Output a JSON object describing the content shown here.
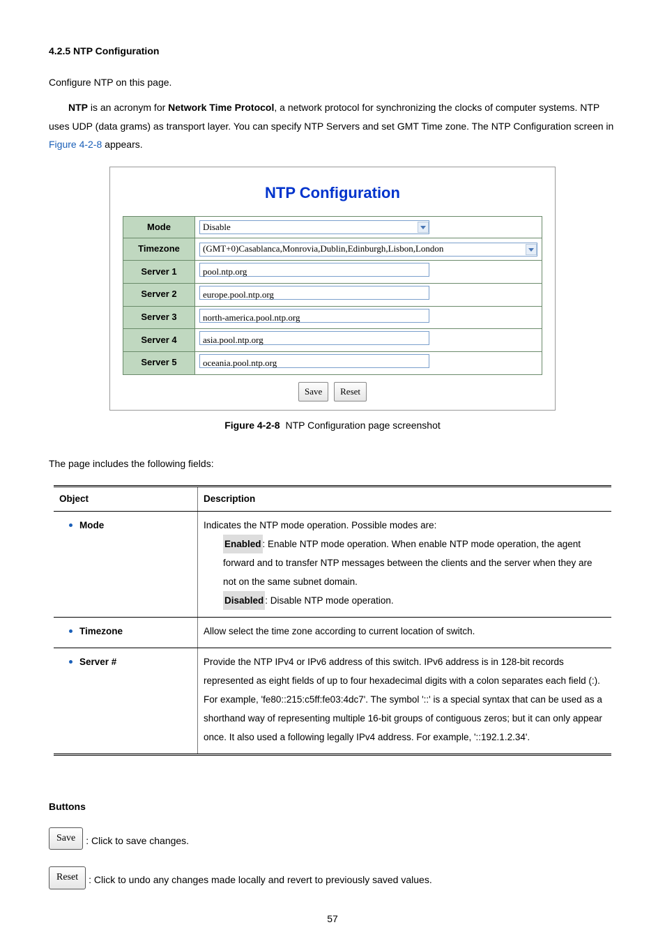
{
  "section": {
    "number": "4.2.5 NTP Configuration",
    "intro": "Configure NTP on this page.",
    "para_prefix": "NTP",
    "para_mid1": " is an acronym for ",
    "para_bold": "Network Time Protocol",
    "para_mid2": ", a network protocol for synchronizing the clocks of computer systems. NTP uses UDP (data grams) as transport layer. You can specify NTP Servers and set GMT Time zone. The NTP Configuration screen in ",
    "figref": "Figure 4-2-8",
    "para_end": " appears."
  },
  "shot": {
    "title": "NTP Configuration",
    "rows": {
      "mode": {
        "label": "Mode",
        "value": "Disable"
      },
      "timezone": {
        "label": "Timezone",
        "value": "(GMT+0)Casablanca,Monrovia,Dublin,Edinburgh,Lisbon,London"
      },
      "s1": {
        "label": "Server 1",
        "value": "pool.ntp.org"
      },
      "s2": {
        "label": "Server 2",
        "value": "europe.pool.ntp.org"
      },
      "s3": {
        "label": "Server 3",
        "value": "north-america.pool.ntp.org"
      },
      "s4": {
        "label": "Server 4",
        "value": "asia.pool.ntp.org"
      },
      "s5": {
        "label": "Server 5",
        "value": "oceania.pool.ntp.org"
      }
    },
    "save": "Save",
    "reset": "Reset"
  },
  "caption": {
    "figno": "Figure 4-2-8",
    "text": " NTP Configuration page screenshot"
  },
  "fields_intro": "The page includes the following fields:",
  "table": {
    "head_obj": "Object",
    "head_desc": "Description",
    "r1": {
      "obj": "Mode",
      "line1": "Indicates the NTP mode operation. Possible modes are:",
      "en_label": "Enabled",
      "en_text": ": Enable NTP mode operation. When enable NTP mode operation, the agent forward and to transfer NTP messages between the clients and the server when they are not on the same subnet domain.",
      "dis_label": "Disabled",
      "dis_text": ": Disable NTP mode operation."
    },
    "r2": {
      "obj": "Timezone",
      "text": "Allow select the time zone according to current location of switch."
    },
    "r3": {
      "obj": "Server #",
      "text": "Provide the NTP IPv4 or IPv6 address of this switch. IPv6 address is in 128-bit records represented as eight fields of up to four hexadecimal digits with a colon separates each field (:). For example, 'fe80::215:c5ff:fe03:4dc7'. The symbol '::' is a special syntax that can be used as a shorthand way of representing multiple 16-bit groups of contiguous zeros; but it can only appear once. It also used a following legally IPv4 address. For example, '::192.1.2.34'."
    }
  },
  "buttons": {
    "heading": "Buttons",
    "save_btn": "Save",
    "save_text": ": Click to save changes.",
    "reset_btn": "Reset",
    "reset_text": ": Click to undo any changes made locally and revert to previously saved values."
  },
  "page_number": "57"
}
